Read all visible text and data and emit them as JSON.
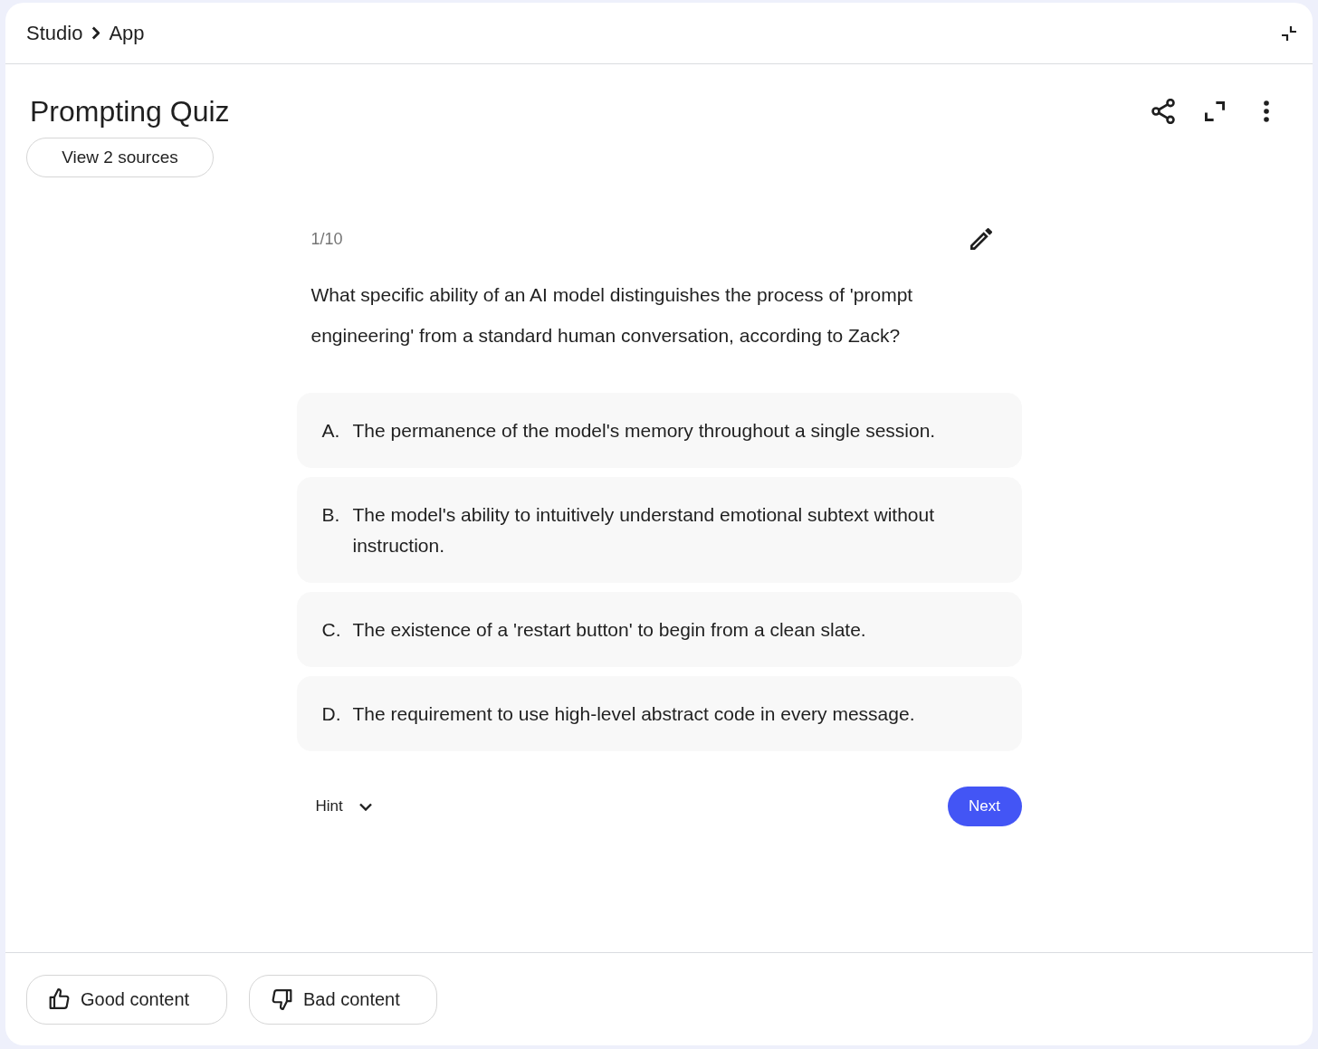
{
  "breadcrumb": [
    {
      "label": "Studio"
    },
    {
      "label": "App"
    }
  ],
  "title": "Prompting Quiz",
  "sources_button": "View 2 sources",
  "quiz": {
    "progress": "1/10",
    "question": "What specific ability of an AI model distinguishes the process of 'prompt engineering' from a standard human conversation, according to Zack?",
    "options": [
      {
        "letter": "A.",
        "text": "The permanence of the model's memory throughout a single session.",
        "selected": false
      },
      {
        "letter": "B.",
        "text": "The model's ability to intuitively understand emotional subtext without instruction.",
        "selected": false
      },
      {
        "letter": "C.",
        "text": "The existence of a 'restart button' to begin from a clean slate.",
        "selected": false
      },
      {
        "letter": "D.",
        "text": "The requirement to use high-level abstract code in every message.",
        "selected": false
      }
    ],
    "hint": {
      "label": "Hint",
      "expanded": false
    },
    "next_button": "Next"
  },
  "feedback": [
    {
      "kind": "good",
      "label": "Good content"
    },
    {
      "kind": "bad",
      "label": "Bad content"
    }
  ]
}
